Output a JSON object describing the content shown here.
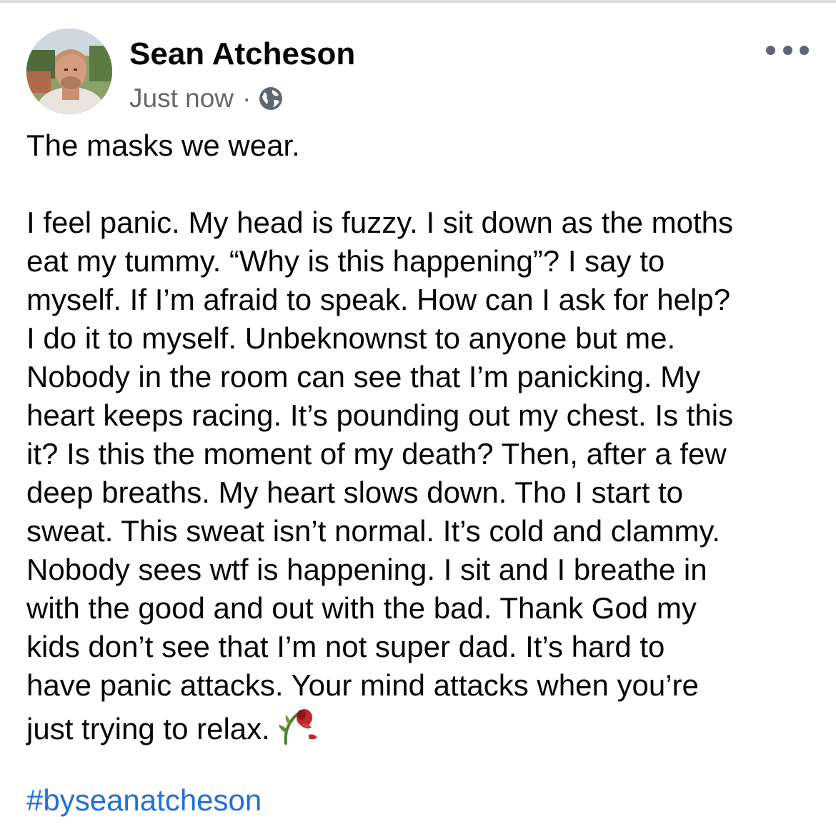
{
  "post": {
    "author": {
      "name": "Sean Atcheson",
      "avatar_alt": "Sean Atcheson profile photo"
    },
    "timestamp": "Just now",
    "separator": "·",
    "privacy_icon": "globe-icon",
    "more_icon": "more-options-icon",
    "title_line": "The masks we wear.",
    "body_lines": [
      "I feel panic. My head is fuzzy. I sit down as the moths",
      "eat my tummy. “Why is this happening”? I say to",
      "myself. If I’m afraid to speak. How can I ask for help?",
      "I do it to myself. Unbeknownst to anyone but me.",
      "Nobody in the room can see that I’m panicking. My",
      "heart keeps racing. It’s pounding out my chest. Is this",
      "it? Is this the moment of my death? Then, after a few",
      "deep breaths. My heart slows down. Tho I start to",
      "sweat. This sweat isn’t normal. It’s cold and clammy.",
      "Nobody sees wtf is happening. I sit and I breathe in",
      "with the good and out with the bad. Thank God my",
      "kids don’t see that I’m not super dad. It’s hard to",
      "have panic attacks. Your mind attacks when you’re",
      "just trying to relax."
    ],
    "ending_emoji": "wilted-rose-emoji",
    "hashtag": "#byseanatcheson"
  },
  "colors": {
    "text": "#050505",
    "meta": "#65676b",
    "link": "#216fdb",
    "icon": "#606770"
  }
}
